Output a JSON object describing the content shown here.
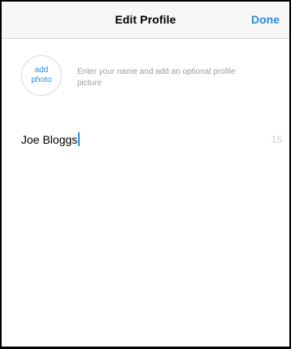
{
  "navbar": {
    "title": "Edit Profile",
    "done_label": "Done"
  },
  "profile": {
    "add_photo_line1": "add",
    "add_photo_line2": "photo",
    "hint": "Enter your name and add an optional profile picture",
    "name_value": "Joe Bloggs",
    "char_count": "15"
  },
  "colors": {
    "accent": "#2a8bd8",
    "hint_text": "#9b9ba0",
    "navbar_bg": "#f7f7f8"
  }
}
